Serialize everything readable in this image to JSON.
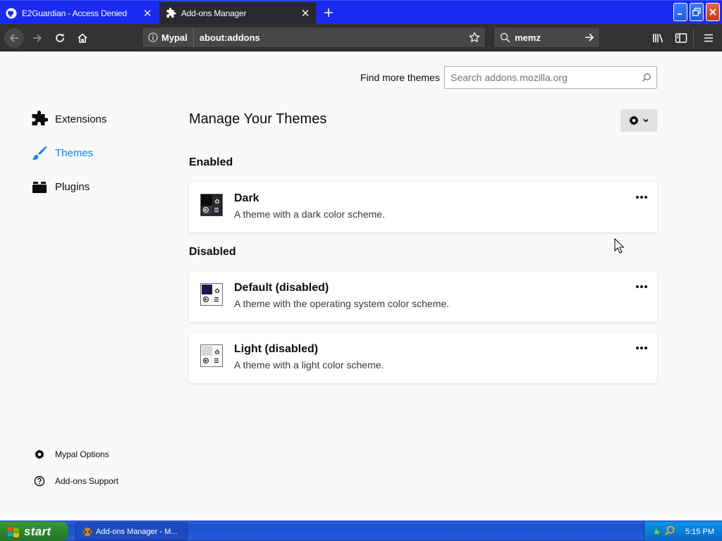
{
  "tabs": [
    {
      "title": "E2Guardian - Access Denied",
      "icon": "github-icon",
      "active": false
    },
    {
      "title": "Add-ons Manager",
      "icon": "puzzle-icon",
      "active": true
    }
  ],
  "toolbar": {
    "identity_label": "Mypal",
    "url": "about:addons",
    "search_value": "memz"
  },
  "find_more": {
    "label": "Find more themes",
    "placeholder": "Search addons.mozilla.org"
  },
  "sidebar": {
    "categories": [
      {
        "label": "Extensions",
        "icon": "puzzle-icon",
        "selected": false
      },
      {
        "label": "Themes",
        "icon": "brush-icon",
        "selected": true
      },
      {
        "label": "Plugins",
        "icon": "plugin-icon",
        "selected": false
      }
    ],
    "footer": [
      {
        "label": "Mypal Options",
        "icon": "gear-icon"
      },
      {
        "label": "Add-ons Support",
        "icon": "help-icon"
      }
    ]
  },
  "main": {
    "title": "Manage Your Themes",
    "enabled_heading": "Enabled",
    "disabled_heading": "Disabled",
    "themes": [
      {
        "name": "Dark",
        "description": "A theme with a dark color scheme.",
        "status": "enabled"
      },
      {
        "name": "Default (disabled)",
        "description": "A theme with the operating system color scheme.",
        "status": "disabled"
      },
      {
        "name": "Light (disabled)",
        "description": "A theme with a light color scheme.",
        "status": "disabled"
      }
    ]
  },
  "taskbar": {
    "start_label": "start",
    "task_label": "Add-ons Manager - M...",
    "clock": "5:15 PM"
  },
  "colors": {
    "accent": "#0a84ff",
    "tabstrip": "#1b2af0",
    "navbar": "#323234"
  }
}
